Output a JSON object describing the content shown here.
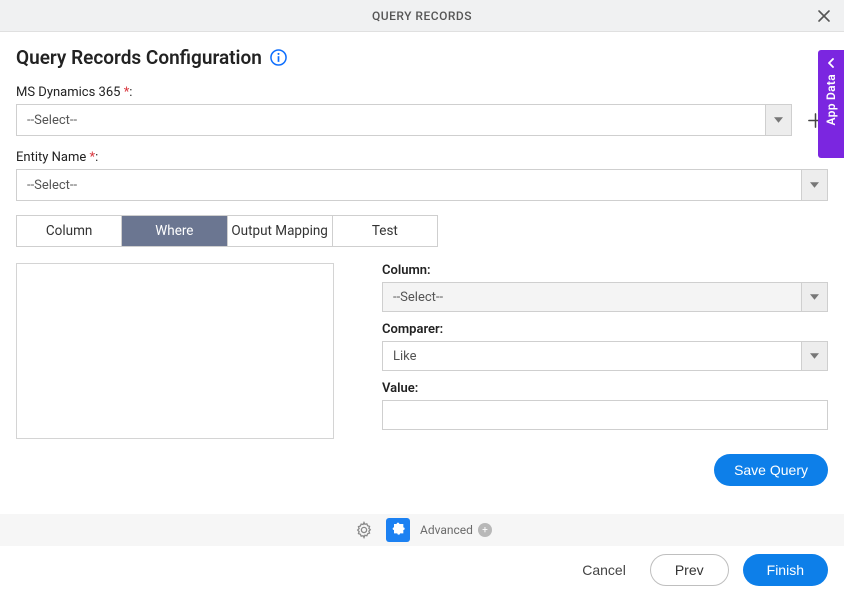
{
  "titlebar": {
    "title": "QUERY RECORDS"
  },
  "page": {
    "title": "Query Records Configuration"
  },
  "fields": {
    "dynamics": {
      "label": "MS Dynamics 365",
      "colon": ":",
      "selected": "--Select--"
    },
    "entity": {
      "label": "Entity Name",
      "colon": ":",
      "selected": "--Select--"
    }
  },
  "tabs": {
    "column": "Column",
    "where": "Where",
    "output_mapping": "Output Mapping",
    "test": "Test"
  },
  "where": {
    "column_label": "Column:",
    "column_selected": "--Select--",
    "comparer_label": "Comparer:",
    "comparer_selected": "Like",
    "value_label": "Value:",
    "value": ""
  },
  "buttons": {
    "save_query": "Save Query",
    "cancel": "Cancel",
    "prev": "Prev",
    "finish": "Finish"
  },
  "footer": {
    "advanced": "Advanced"
  },
  "side_tab": {
    "label": "App Data"
  },
  "required_marker": "*"
}
